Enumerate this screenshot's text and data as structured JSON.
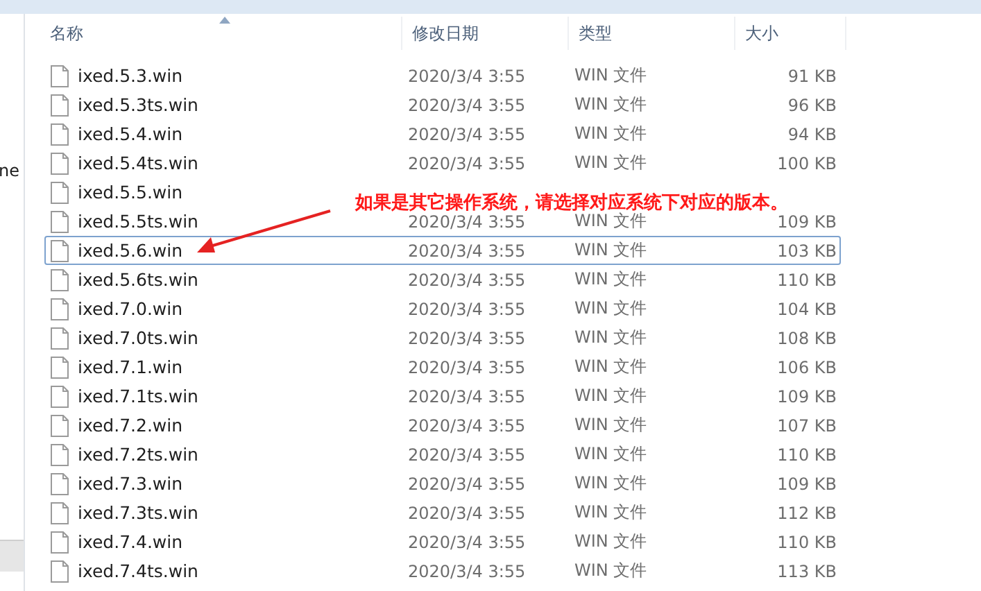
{
  "nav_pane": {
    "item_text": "ne"
  },
  "columns": [
    "名称",
    "修改日期",
    "类型",
    "大小"
  ],
  "rows": [
    {
      "name": "ixed.5.3.win",
      "date": "2020/3/4 3:55",
      "type": "WIN 文件",
      "size": "91 KB",
      "focused": false
    },
    {
      "name": "ixed.5.3ts.win",
      "date": "2020/3/4 3:55",
      "type": "WIN 文件",
      "size": "96 KB",
      "focused": false
    },
    {
      "name": "ixed.5.4.win",
      "date": "2020/3/4 3:55",
      "type": "WIN 文件",
      "size": "94 KB",
      "focused": false
    },
    {
      "name": "ixed.5.4ts.win",
      "date": "2020/3/4 3:55",
      "type": "WIN 文件",
      "size": "100 KB",
      "focused": false
    },
    {
      "name": "ixed.5.5.win",
      "focused": false
    },
    {
      "name": "ixed.5.5ts.win",
      "date": "2020/3/4 3:55",
      "type": "WIN 文件",
      "size": "109 KB",
      "focused": false
    },
    {
      "name": "ixed.5.6.win",
      "date": "2020/3/4 3:55",
      "type": "WIN 文件",
      "size": "103 KB",
      "focused": true
    },
    {
      "name": "ixed.5.6ts.win",
      "date": "2020/3/4 3:55",
      "type": "WIN 文件",
      "size": "110 KB",
      "focused": false
    },
    {
      "name": "ixed.7.0.win",
      "date": "2020/3/4 3:55",
      "type": "WIN 文件",
      "size": "104 KB",
      "focused": false
    },
    {
      "name": "ixed.7.0ts.win",
      "date": "2020/3/4 3:55",
      "type": "WIN 文件",
      "size": "108 KB",
      "focused": false
    },
    {
      "name": "ixed.7.1.win",
      "date": "2020/3/4 3:55",
      "type": "WIN 文件",
      "size": "106 KB",
      "focused": false
    },
    {
      "name": "ixed.7.1ts.win",
      "date": "2020/3/4 3:55",
      "type": "WIN 文件",
      "size": "109 KB",
      "focused": false
    },
    {
      "name": "ixed.7.2.win",
      "date": "2020/3/4 3:55",
      "type": "WIN 文件",
      "size": "107 KB",
      "focused": false
    },
    {
      "name": "ixed.7.2ts.win",
      "date": "2020/3/4 3:55",
      "type": "WIN 文件",
      "size": "110 KB",
      "focused": false
    },
    {
      "name": "ixed.7.3.win",
      "date": "2020/3/4 3:55",
      "type": "WIN 文件",
      "size": "109 KB",
      "focused": false
    },
    {
      "name": "ixed.7.3ts.win",
      "date": "2020/3/4 3:55",
      "type": "WIN 文件",
      "size": "112 KB",
      "focused": false
    },
    {
      "name": "ixed.7.4.win",
      "date": "2020/3/4 3:55",
      "type": "WIN 文件",
      "size": "110 KB",
      "focused": false
    },
    {
      "name": "ixed.7.4ts.win",
      "date": "2020/3/4 3:55",
      "type": "WIN 文件",
      "size": "113 KB",
      "focused": false
    }
  ],
  "annotation": {
    "text": "如果是其它操作系统，请选择对应系统下对应的版本。"
  }
}
